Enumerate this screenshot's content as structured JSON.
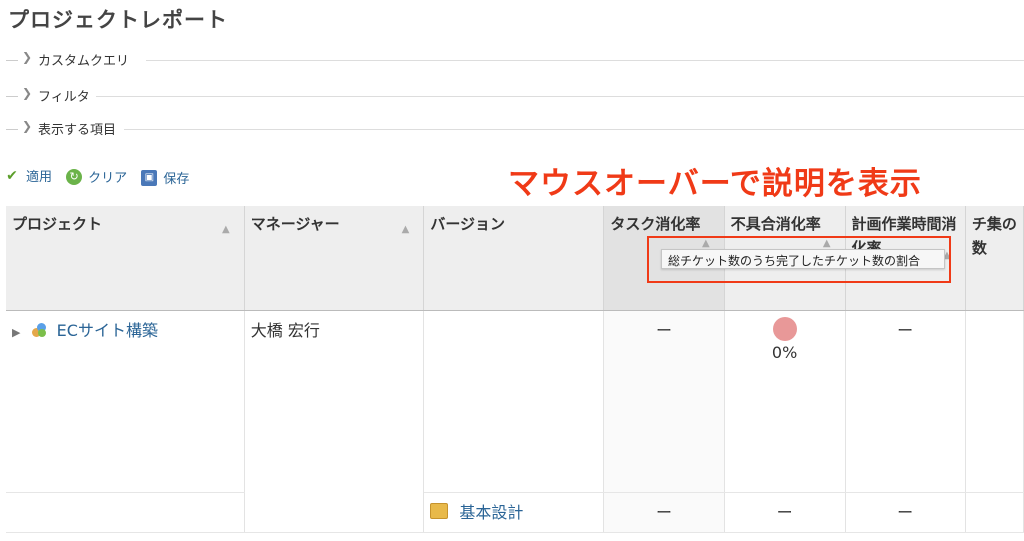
{
  "page": {
    "title": "プロジェクトレポート"
  },
  "sections": [
    {
      "label": "カスタムクエリ"
    },
    {
      "label": "フィルタ"
    },
    {
      "label": "表示する項目"
    }
  ],
  "actions": [
    {
      "label": "適用",
      "icon": "check-icon"
    },
    {
      "label": "クリア",
      "icon": "refresh-icon"
    },
    {
      "label": "保存",
      "icon": "save-icon"
    }
  ],
  "annotation": {
    "text": "マウスオーバーで説明を表示",
    "color": "#f03a17"
  },
  "tooltip": {
    "text": "総チケット数のうち完了したチケット数の割合"
  },
  "table": {
    "headers": [
      {
        "label": "プロジェクト"
      },
      {
        "label": "マネージャー"
      },
      {
        "label": "バージョン"
      },
      {
        "label": "タスク消化率"
      },
      {
        "label": "不具合消化率"
      },
      {
        "label": "計画作業時間消化率"
      },
      {
        "label": "チ集の数"
      }
    ],
    "rows": [
      {
        "project": "ECサイト構築",
        "manager": "大橋 宏行",
        "version": "",
        "task_rate": "ー",
        "bug_rate": "0%",
        "plan_rate": "ー"
      },
      {
        "project": "",
        "manager": "",
        "version": "基本設計",
        "task_rate": "ー",
        "bug_rate": "ー",
        "plan_rate": "ー"
      }
    ]
  },
  "colors": {
    "link": "#2a6496",
    "accent": "#f03a17",
    "bug_dot": "#e89898"
  }
}
